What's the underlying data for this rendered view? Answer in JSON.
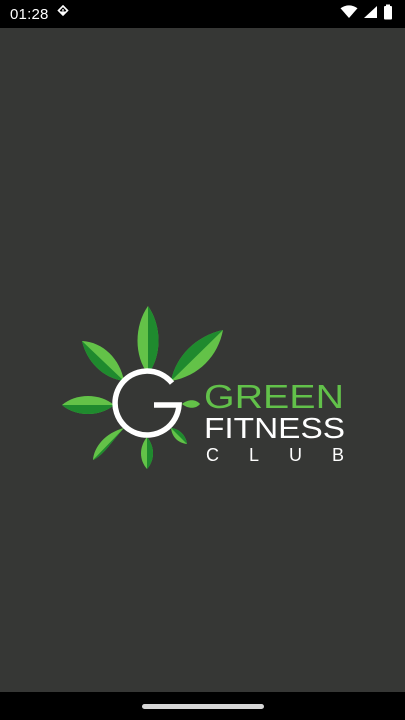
{
  "status_bar": {
    "time": "01:28",
    "notification_icon": "download-icon",
    "wifi_icon": "wifi-icon",
    "signal_icon": "cell-signal-icon",
    "battery_icon": "battery-icon"
  },
  "splash": {
    "background": "#363735",
    "logo": {
      "line1": "GREEN",
      "line2": "FITNESS",
      "line3": "CLUB",
      "emblem_letter": "G",
      "accent_color": "#62c14a",
      "leaf_dark": "#1f8a2e",
      "leaf_light": "#63c248"
    }
  },
  "nav_bar": {
    "home_indicator": "home-gesture-bar"
  }
}
